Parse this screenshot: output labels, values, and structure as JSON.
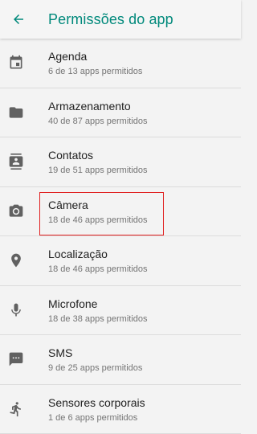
{
  "header": {
    "title": "Permissões do app",
    "back_icon": "arrow-left-icon"
  },
  "colors": {
    "accent": "#00897b",
    "highlight": "#e02020",
    "icon": "#616161"
  },
  "permissions": [
    {
      "label": "Agenda",
      "sub": "6 de 13 apps permitidos",
      "icon": "calendar-icon"
    },
    {
      "label": "Armazenamento",
      "sub": "40 de 87 apps permitidos",
      "icon": "folder-icon"
    },
    {
      "label": "Contatos",
      "sub": "19 de 51 apps permitidos",
      "icon": "contacts-icon"
    },
    {
      "label": "Câmera",
      "sub": "18 de 46 apps permitidos",
      "icon": "camera-icon"
    },
    {
      "label": "Localização",
      "sub": "18 de 46 apps permitidos",
      "icon": "location-pin-icon"
    },
    {
      "label": "Microfone",
      "sub": "18 de 38 apps permitidos",
      "icon": "microphone-icon"
    },
    {
      "label": "SMS",
      "sub": "9 de 25 apps permitidos",
      "icon": "sms-icon"
    },
    {
      "label": "Sensores corporais",
      "sub": "1 de 6 apps permitidos",
      "icon": "body-sensor-icon"
    }
  ]
}
